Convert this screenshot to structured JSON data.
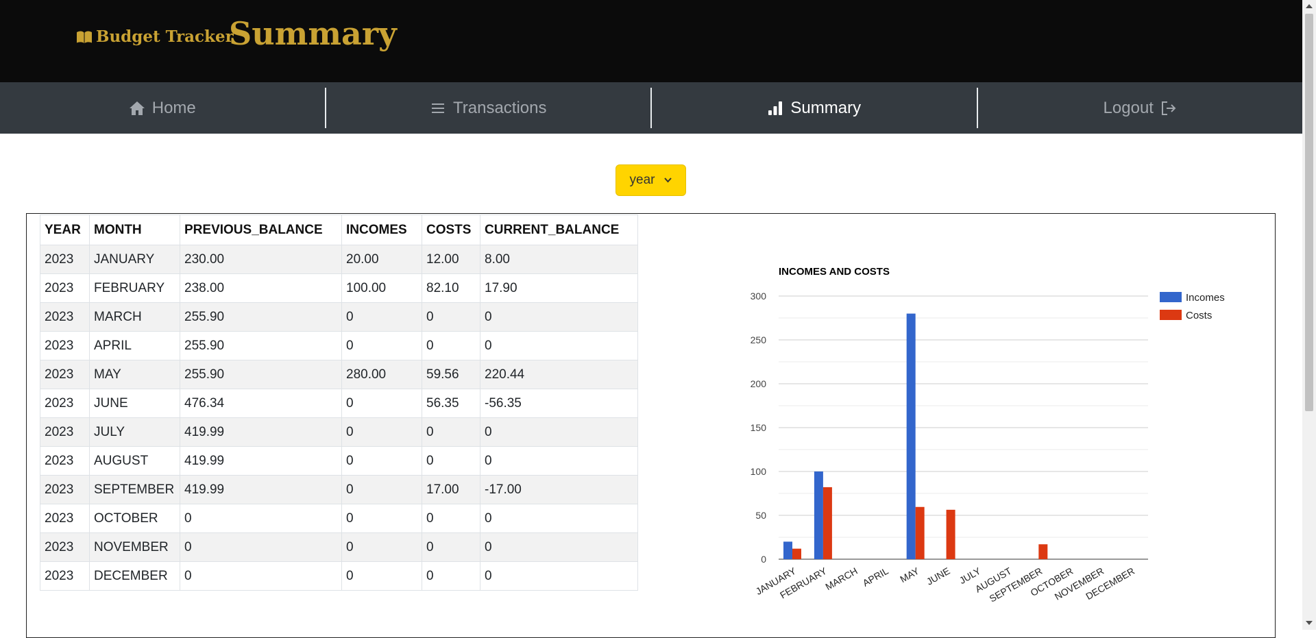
{
  "header": {
    "brand": "Budget Tracker",
    "page_title": "Summary"
  },
  "nav": {
    "home": "Home",
    "transactions": "Transactions",
    "summary": "Summary",
    "logout": "Logout"
  },
  "year_select": {
    "value": "year"
  },
  "table": {
    "columns": [
      "YEAR",
      "MONTH",
      "PREVIOUS_BALANCE",
      "INCOMES",
      "COSTS",
      "CURRENT_BALANCE"
    ],
    "rows": [
      [
        "2023",
        "JANUARY",
        "230.00",
        "20.00",
        "12.00",
        "8.00"
      ],
      [
        "2023",
        "FEBRUARY",
        "238.00",
        "100.00",
        "82.10",
        "17.90"
      ],
      [
        "2023",
        "MARCH",
        "255.90",
        "0",
        "0",
        "0"
      ],
      [
        "2023",
        "APRIL",
        "255.90",
        "0",
        "0",
        "0"
      ],
      [
        "2023",
        "MAY",
        "255.90",
        "280.00",
        "59.56",
        "220.44"
      ],
      [
        "2023",
        "JUNE",
        "476.34",
        "0",
        "56.35",
        "-56.35"
      ],
      [
        "2023",
        "JULY",
        "419.99",
        "0",
        "0",
        "0"
      ],
      [
        "2023",
        "AUGUST",
        "419.99",
        "0",
        "0",
        "0"
      ],
      [
        "2023",
        "SEPTEMBER",
        "419.99",
        "0",
        "17.00",
        "-17.00"
      ],
      [
        "2023",
        "OCTOBER",
        "0",
        "0",
        "0",
        "0"
      ],
      [
        "2023",
        "NOVEMBER",
        "0",
        "0",
        "0",
        "0"
      ],
      [
        "2023",
        "DECEMBER",
        "0",
        "0",
        "0",
        "0"
      ]
    ]
  },
  "colors": {
    "brand_gold": "#c9a233",
    "select_yellow": "#ffd400",
    "incomes": "#3366cc",
    "costs": "#dc3912"
  },
  "chart_data": {
    "type": "bar",
    "title": "INCOMES AND COSTS",
    "categories": [
      "JANUARY",
      "FEBRUARY",
      "MARCH",
      "APRIL",
      "MAY",
      "JUNE",
      "JULY",
      "AUGUST",
      "SEPTEMBER",
      "OCTOBER",
      "NOVEMBER",
      "DECEMBER"
    ],
    "series": [
      {
        "name": "Incomes",
        "values": [
          20,
          100,
          0,
          0,
          280,
          0,
          0,
          0,
          0,
          0,
          0,
          0
        ],
        "color": "#3366cc"
      },
      {
        "name": "Costs",
        "values": [
          12,
          82.1,
          0,
          0,
          59.56,
          56.35,
          0,
          0,
          17,
          0,
          0,
          0
        ],
        "color": "#dc3912"
      }
    ],
    "ylim": [
      0,
      300
    ],
    "yticks": [
      0,
      50,
      100,
      150,
      200,
      250,
      300
    ],
    "grid": true,
    "legend": "right"
  }
}
